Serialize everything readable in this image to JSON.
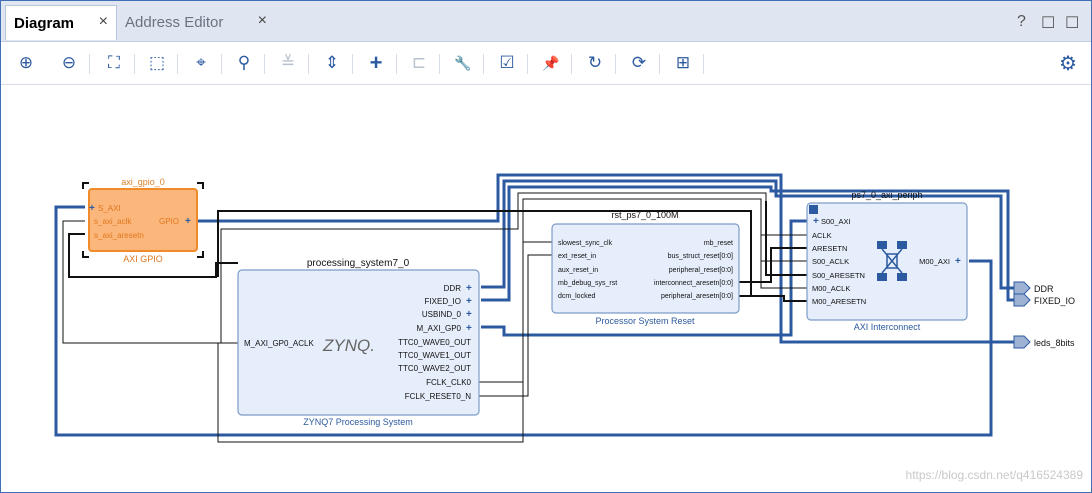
{
  "tabs": [
    {
      "label": "Diagram",
      "close": "×"
    },
    {
      "label": "Address Editor",
      "close": "×"
    }
  ],
  "window_controls": {
    "help": "?",
    "restore": "☐",
    "maximize": "☐"
  },
  "toolbar": [
    {
      "icon": "zoom-in-icon",
      "glyph": "⊕"
    },
    {
      "icon": "zoom-out-icon",
      "glyph": "⊖"
    },
    {
      "icon": "zoom-fit-icon",
      "glyph": "⛶"
    },
    {
      "icon": "zoom-area-icon",
      "glyph": "⬚"
    },
    {
      "icon": "auto-connect-icon",
      "glyph": "⌖"
    },
    {
      "icon": "search-icon",
      "glyph": "⚲"
    },
    {
      "icon": "collapse-icon",
      "glyph": "≚"
    },
    {
      "icon": "expand-icon",
      "glyph": "⇕"
    },
    {
      "icon": "add-ip-icon",
      "glyph": "+"
    },
    {
      "icon": "add-module-icon",
      "glyph": "⊏"
    },
    {
      "icon": "wrench-icon",
      "glyph": "🔧"
    },
    {
      "icon": "validate-icon",
      "glyph": "☑"
    },
    {
      "icon": "pin-icon",
      "glyph": "📌"
    },
    {
      "icon": "refresh-icon",
      "glyph": "↻"
    },
    {
      "icon": "regenerate-icon",
      "glyph": "⟳"
    },
    {
      "icon": "port-icon",
      "glyph": "⊞"
    }
  ],
  "settings_icon": "⚙",
  "blocks": {
    "gpio": {
      "instance": "axi_gpio_0",
      "type": "AXI GPIO",
      "ports_left": [
        "S_AXI",
        "s_axi_aclk",
        "s_axi_aresetn"
      ],
      "ports_right": [
        "GPIO"
      ]
    },
    "zynq": {
      "instance": "processing_system7_0",
      "type": "ZYNQ7 Processing System",
      "logo": "ZYNQ.",
      "ports_left": [
        "M_AXI_GP0_ACLK"
      ],
      "ports_right": [
        "DDR",
        "FIXED_IO",
        "USBIND_0",
        "M_AXI_GP0",
        "TTC0_WAVE0_OUT",
        "TTC0_WAVE1_OUT",
        "TTC0_WAVE2_OUT",
        "FCLK_CLK0",
        "FCLK_RESET0_N"
      ]
    },
    "rst": {
      "instance": "rst_ps7_0_100M",
      "type": "Processor System Reset",
      "ports_left": [
        "slowest_sync_clk",
        "ext_reset_in",
        "aux_reset_in",
        "mb_debug_sys_rst",
        "dcm_locked"
      ],
      "ports_right": [
        "mb_reset",
        "bus_struct_reset[0:0]",
        "peripheral_reset[0:0]",
        "interconnect_aresetn[0:0]",
        "peripheral_aresetn[0:0]"
      ]
    },
    "ic": {
      "instance": "ps7_0_axi_periph",
      "type": "AXI Interconnect",
      "ports_left": [
        "S00_AXI",
        "ACLK",
        "ARESETN",
        "S00_ACLK",
        "S00_ARESETN",
        "M00_ACLK",
        "M00_ARESETN"
      ],
      "ports_right": [
        "M00_AXI"
      ]
    }
  },
  "external_ports": [
    "DDR",
    "FIXED_IO",
    "leds_8bits"
  ],
  "watermark": "https://blog.csdn.net/q416524389",
  "colors": {
    "accent": "#2c5aa0",
    "block_fill": "#e6eefb",
    "block_border": "#7d9cc7",
    "selected": "#f6a25b",
    "bus": "#2c5aa0",
    "wire": "#111111"
  }
}
